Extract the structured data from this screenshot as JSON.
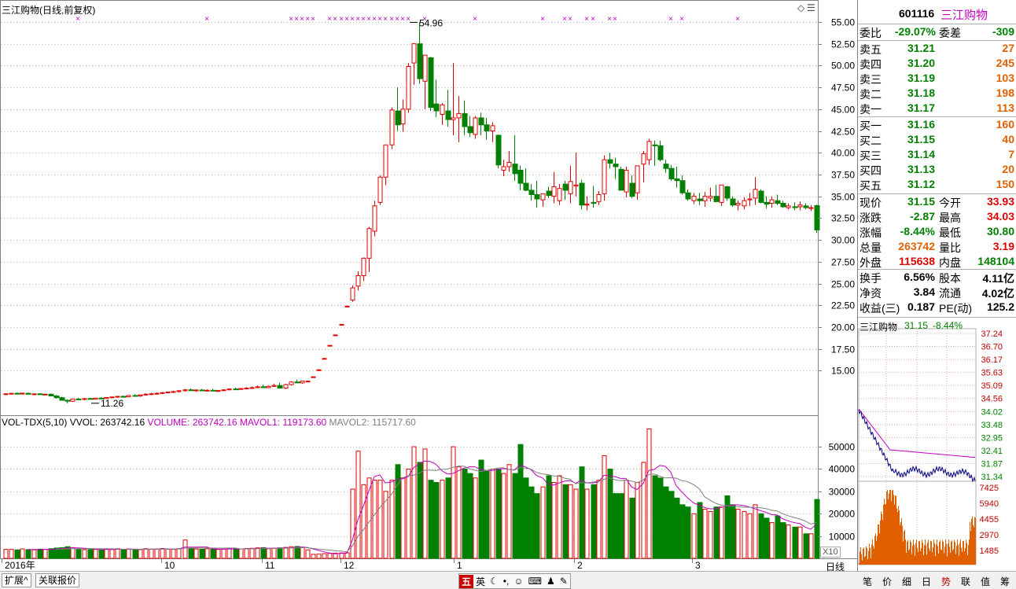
{
  "chart_title": "三江购物(日线,前复权)",
  "stock": {
    "code": "601116",
    "name": "三江购物"
  },
  "colors": {
    "up": "#e00000",
    "down": "#008000",
    "purple": "#c000c0",
    "orange": "#e06000"
  },
  "order_book": {
    "weibi_label": "委比",
    "weibi_value": "-29.07%",
    "weicha_label": "委差",
    "weicha_value": "-309",
    "asks": [
      {
        "label": "卖五",
        "price": "31.21",
        "vol": "27"
      },
      {
        "label": "卖四",
        "price": "31.20",
        "vol": "245"
      },
      {
        "label": "卖三",
        "price": "31.19",
        "vol": "103"
      },
      {
        "label": "卖二",
        "price": "31.18",
        "vol": "198"
      },
      {
        "label": "卖一",
        "price": "31.17",
        "vol": "113"
      }
    ],
    "bids": [
      {
        "label": "买一",
        "price": "31.16",
        "vol": "160"
      },
      {
        "label": "买二",
        "price": "31.15",
        "vol": "40"
      },
      {
        "label": "买三",
        "price": "31.14",
        "vol": "7"
      },
      {
        "label": "买四",
        "price": "31.13",
        "vol": "20"
      },
      {
        "label": "买五",
        "price": "31.12",
        "vol": "150"
      }
    ]
  },
  "quote": [
    {
      "l1": "现价",
      "v1": "31.15",
      "l2": "今开",
      "v2": "33.93"
    },
    {
      "l1": "涨跌",
      "v1": "-2.87",
      "l2": "最高",
      "v2": "34.03"
    },
    {
      "l1": "涨幅",
      "v1": "-8.44%",
      "l2": "最低",
      "v2": "30.80"
    },
    {
      "l1": "总量",
      "v1": "263742",
      "l2": "量比",
      "v2": "3.19"
    },
    {
      "l1": "外盘",
      "v1": "115638",
      "l2": "内盘",
      "v2": "148104"
    }
  ],
  "fundamentals": [
    {
      "l1": "换手",
      "v1": "6.56%",
      "l2": "股本",
      "v2": "4.11亿"
    },
    {
      "l1": "净资",
      "v1": "3.84",
      "l2": "流通",
      "v2": "4.02亿"
    },
    {
      "l1": "收益(三)",
      "v1": "0.187",
      "l2": "PE(动)",
      "v2": "125.2"
    }
  ],
  "intraday": {
    "name": "三江购物",
    "price": "31.15",
    "change": "-8.44%",
    "price_ticks": [
      "37.24",
      "36.70",
      "36.17",
      "35.63",
      "35.09",
      "34.56",
      "34.02",
      "33.48",
      "32.95",
      "32.41",
      "31.87",
      "31.34"
    ],
    "vol_ticks": [
      "7425",
      "5940",
      "4455",
      "2970",
      "1485"
    ]
  },
  "volume_legend": {
    "name": "VOL-TDX(5,10)",
    "vvol": "VVOL: 263742.16",
    "volume": "VOLUME: 263742.16",
    "mavol1": "MAVOL1: 119173.60",
    "mavol2": "MAVOL2: 115717.60"
  },
  "x_labels": [
    "2016年",
    "10",
    "11",
    "12",
    "1",
    "2",
    "3"
  ],
  "period_label": "日线",
  "x10_label": "X10",
  "bottom_tabs": [
    "扩展^",
    "关联报价"
  ],
  "ime_items": [
    "五",
    "英"
  ],
  "right_tabs": [
    "笔",
    "价",
    "细",
    "日",
    "势",
    "联",
    "值",
    "筹"
  ],
  "chart_data": {
    "type": "candlestick",
    "title": "三江购物(日线,前复权)",
    "price_axis": {
      "ticks": [
        15.0,
        17.5,
        20.0,
        22.5,
        25.0,
        27.5,
        30.0,
        32.5,
        35.0,
        37.5,
        40.0,
        42.5,
        45.0,
        47.5,
        50.0,
        52.5,
        55.0
      ]
    },
    "volume_axis": {
      "ticks": [
        10000,
        20000,
        30000,
        40000,
        50000
      ]
    },
    "annotations": [
      {
        "text": "54.96",
        "value": 54.96
      },
      {
        "text": "11.26",
        "value": 11.26
      }
    ],
    "candles": [
      [
        12.3,
        12.4,
        12.2,
        12.35,
        4000
      ],
      [
        12.35,
        12.45,
        12.25,
        12.4,
        4000
      ],
      [
        12.4,
        12.5,
        12.3,
        12.35,
        3800
      ],
      [
        12.35,
        12.45,
        12.25,
        12.42,
        4200
      ],
      [
        12.4,
        12.5,
        12.3,
        12.3,
        3900
      ],
      [
        12.3,
        12.4,
        12.2,
        12.34,
        3800
      ],
      [
        12.34,
        12.42,
        12.25,
        12.28,
        4100
      ],
      [
        12.28,
        12.36,
        12.2,
        12.3,
        4000
      ],
      [
        12.3,
        12.38,
        12.1,
        12.1,
        4300
      ],
      [
        12.1,
        12.2,
        11.8,
        11.9,
        4600
      ],
      [
        11.9,
        12.0,
        11.6,
        11.6,
        4800
      ],
      [
        11.6,
        11.7,
        11.26,
        11.5,
        5200
      ],
      [
        11.5,
        11.8,
        11.4,
        11.75,
        4800
      ],
      [
        11.75,
        11.9,
        11.6,
        11.7,
        4000
      ],
      [
        11.7,
        11.85,
        11.6,
        11.8,
        3900
      ],
      [
        11.8,
        11.9,
        11.7,
        11.72,
        3900
      ],
      [
        11.72,
        11.9,
        11.7,
        11.85,
        4000
      ],
      [
        11.85,
        11.95,
        11.75,
        11.8,
        3800
      ],
      [
        11.8,
        11.95,
        11.75,
        11.92,
        4100
      ],
      [
        11.92,
        12.05,
        11.85,
        11.98,
        4000
      ],
      [
        11.98,
        12.1,
        11.9,
        12.05,
        4300
      ],
      [
        12.05,
        12.15,
        11.95,
        12.0,
        4000
      ],
      [
        12.0,
        12.2,
        11.95,
        12.15,
        4200
      ],
      [
        12.15,
        12.3,
        12.05,
        12.1,
        4000
      ],
      [
        12.1,
        12.25,
        12.0,
        12.22,
        3900
      ],
      [
        12.22,
        12.4,
        12.15,
        12.3,
        4300
      ],
      [
        12.3,
        12.45,
        12.2,
        12.35,
        4100
      ],
      [
        12.35,
        12.5,
        12.25,
        12.4,
        4200
      ],
      [
        12.4,
        12.55,
        12.3,
        12.48,
        4400
      ],
      [
        12.48,
        12.6,
        12.4,
        12.55,
        4100
      ],
      [
        12.55,
        12.7,
        12.45,
        12.6,
        4000
      ],
      [
        12.6,
        12.75,
        12.5,
        12.7,
        4300
      ],
      [
        12.7,
        12.9,
        12.6,
        12.8,
        8200
      ],
      [
        12.8,
        12.95,
        12.7,
        12.72,
        4500
      ],
      [
        12.72,
        12.85,
        12.6,
        12.78,
        4200
      ],
      [
        12.78,
        12.9,
        12.65,
        12.7,
        4100
      ],
      [
        12.7,
        12.85,
        12.6,
        12.75,
        4300
      ],
      [
        12.75,
        12.9,
        12.65,
        12.68,
        4200
      ],
      [
        12.68,
        12.8,
        12.55,
        12.72,
        4000
      ],
      [
        12.72,
        12.85,
        12.65,
        12.8,
        4100
      ],
      [
        12.8,
        12.95,
        12.75,
        12.9,
        4300
      ],
      [
        12.9,
        13.05,
        12.8,
        12.85,
        4400
      ],
      [
        12.85,
        13.0,
        12.8,
        12.95,
        4200
      ],
      [
        12.95,
        13.1,
        12.85,
        13.0,
        4400
      ],
      [
        13.0,
        13.2,
        12.95,
        13.05,
        4500
      ],
      [
        13.05,
        13.3,
        13.0,
        13.15,
        4700
      ],
      [
        13.15,
        13.4,
        13.05,
        13.05,
        4800
      ],
      [
        13.05,
        13.3,
        13.0,
        13.2,
        4300
      ],
      [
        13.2,
        13.5,
        13.15,
        13.3,
        4500
      ],
      [
        13.3,
        13.6,
        13.25,
        13.0,
        4700
      ],
      [
        13.0,
        13.5,
        12.9,
        13.4,
        4900
      ],
      [
        13.4,
        13.8,
        13.3,
        13.7,
        5200
      ],
      [
        13.7,
        14.0,
        13.6,
        13.6,
        5300
      ],
      [
        13.6,
        13.8,
        13.5,
        13.8,
        5000
      ],
      [
        13.8,
        13.85,
        13.8,
        13.8,
        3800
      ],
      [
        14.3,
        14.35,
        14.3,
        14.3,
        1800
      ],
      [
        15.1,
        15.15,
        15.1,
        15.1,
        1900
      ],
      [
        16.4,
        16.45,
        16.4,
        16.4,
        2100
      ],
      [
        17.9,
        17.95,
        17.9,
        17.9,
        2200
      ],
      [
        19.1,
        19.15,
        19.1,
        19.1,
        2300
      ],
      [
        20.3,
        20.35,
        20.3,
        20.3,
        2400
      ],
      [
        22.4,
        22.45,
        22.4,
        22.4,
        2500
      ],
      [
        23.1,
        24.8,
        22.9,
        24.5,
        31000
      ],
      [
        24.7,
        26.4,
        24.2,
        25.9,
        48000
      ],
      [
        25.9,
        28.0,
        25.3,
        27.9,
        33000
      ],
      [
        27.9,
        31.5,
        26.3,
        31.3,
        36000
      ],
      [
        31.0,
        34.5,
        30.4,
        33.9,
        35000
      ],
      [
        34.3,
        37.4,
        34.0,
        37.2,
        35000
      ],
      [
        37.2,
        40.9,
        36.3,
        40.9,
        30000
      ],
      [
        40.9,
        45.2,
        40.4,
        44.9,
        35000
      ],
      [
        44.8,
        47.5,
        42.5,
        43.2,
        42000
      ],
      [
        43.3,
        46.1,
        42.4,
        45.0,
        36000
      ],
      [
        45.0,
        50.3,
        44.6,
        49.9,
        40000
      ],
      [
        50.3,
        52.6,
        47.8,
        52.5,
        50000
      ],
      [
        52.5,
        54.96,
        47.9,
        48.5,
        43000
      ],
      [
        48.2,
        50.5,
        45.0,
        51.2,
        49000
      ],
      [
        50.9,
        51.0,
        44.8,
        45.2,
        35000
      ],
      [
        45.6,
        48.4,
        44.1,
        44.8,
        34000
      ],
      [
        44.4,
        45.7,
        43.2,
        45.5,
        35000
      ],
      [
        44.8,
        47.2,
        43.0,
        43.8,
        36000
      ],
      [
        43.8,
        50.3,
        42.0,
        44.0,
        50000
      ],
      [
        44.0,
        46.5,
        41.2,
        44.5,
        41000
      ],
      [
        44.5,
        46.0,
        42.0,
        43.0,
        40000
      ],
      [
        43.0,
        44.2,
        41.8,
        42.3,
        38000
      ],
      [
        42.1,
        44.2,
        41.6,
        44.0,
        36000
      ],
      [
        44.0,
        44.6,
        42.0,
        43.2,
        44000
      ],
      [
        43.2,
        44.0,
        41.5,
        42.5,
        39000
      ],
      [
        42.5,
        43.5,
        41.2,
        43.1,
        40000
      ],
      [
        42.0,
        42.1,
        38.2,
        38.6,
        40000
      ],
      [
        38.0,
        39.2,
        37.3,
        38.4,
        38000
      ],
      [
        38.4,
        40.2,
        37.8,
        38.9,
        42000
      ],
      [
        38.7,
        42.0,
        36.8,
        37.6,
        38000
      ],
      [
        38.0,
        38.5,
        35.7,
        36.5,
        51000
      ],
      [
        36.5,
        38.2,
        35.6,
        35.7,
        36000
      ],
      [
        35.7,
        36.4,
        34.5,
        35.2,
        32000
      ],
      [
        35.2,
        36.8,
        33.7,
        34.7,
        29000
      ],
      [
        34.6,
        35.3,
        33.8,
        35.3,
        32000
      ],
      [
        35.6,
        36.1,
        34.8,
        35.1,
        37000
      ],
      [
        35.0,
        37.8,
        34.2,
        36.1,
        34000
      ],
      [
        34.5,
        36.4,
        34.0,
        35.9,
        37000
      ],
      [
        36.4,
        36.8,
        34.6,
        35.7,
        33000
      ],
      [
        35.3,
        38.5,
        34.2,
        36.7,
        33000
      ],
      [
        36.2,
        40.0,
        35.0,
        36.3,
        31000
      ],
      [
        36.5,
        36.9,
        33.5,
        34.0,
        41000
      ],
      [
        34.0,
        35.0,
        33.4,
        34.1,
        31000
      ],
      [
        34.3,
        36.2,
        33.7,
        34.2,
        33000
      ],
      [
        34.4,
        35.6,
        34.0,
        35.2,
        35000
      ],
      [
        35.3,
        39.7,
        34.5,
        39.2,
        46000
      ],
      [
        39.2,
        40.0,
        38.2,
        38.8,
        40000
      ],
      [
        38.7,
        39.4,
        37.0,
        38.4,
        29000
      ],
      [
        38.1,
        38.4,
        35.8,
        35.7,
        29000
      ],
      [
        35.5,
        38.4,
        34.9,
        38.0,
        35000
      ],
      [
        36.5,
        37.4,
        34.8,
        35.0,
        27000
      ],
      [
        35.4,
        38.4,
        34.6,
        38.5,
        34000
      ],
      [
        38.7,
        40.2,
        36.6,
        39.9,
        43000
      ],
      [
        39.2,
        41.6,
        38.6,
        41.3,
        58000
      ],
      [
        40.9,
        41.4,
        38.5,
        40.8,
        37000
      ],
      [
        40.8,
        41.4,
        39.0,
        39.2,
        36000
      ],
      [
        38.7,
        39.2,
        37.7,
        38.2,
        32000
      ],
      [
        38.2,
        38.6,
        36.8,
        37.0,
        30000
      ],
      [
        37.0,
        38.4,
        36.0,
        36.8,
        27000
      ],
      [
        36.8,
        37.4,
        35.2,
        35.4,
        24000
      ],
      [
        35.4,
        35.8,
        34.5,
        34.7,
        23000
      ],
      [
        34.5,
        35.4,
        34.1,
        35.0,
        20000
      ],
      [
        34.7,
        35.4,
        34.0,
        34.5,
        25000
      ],
      [
        34.5,
        35.5,
        33.8,
        35.0,
        22000
      ],
      [
        34.8,
        36.0,
        34.4,
        35.0,
        21000
      ],
      [
        35.0,
        36.3,
        34.3,
        34.4,
        23000
      ],
      [
        34.3,
        36.3,
        33.9,
        36.3,
        23000
      ],
      [
        36.1,
        36.2,
        34.5,
        34.8,
        28000
      ],
      [
        34.7,
        35.0,
        33.8,
        34.0,
        24000
      ],
      [
        34.0,
        34.5,
        33.4,
        34.2,
        22000
      ],
      [
        33.9,
        34.9,
        33.5,
        34.5,
        21000
      ],
      [
        34.6,
        35.4,
        33.9,
        34.7,
        20000
      ],
      [
        34.8,
        37.2,
        34.0,
        35.8,
        24000
      ],
      [
        35.6,
        35.8,
        34.2,
        34.3,
        20000
      ],
      [
        34.3,
        35.0,
        33.6,
        34.1,
        18000
      ],
      [
        34.2,
        35.0,
        33.7,
        34.6,
        16000
      ],
      [
        34.5,
        35.2,
        34.0,
        34.2,
        19000
      ],
      [
        34.2,
        34.5,
        33.7,
        33.8,
        16000
      ],
      [
        33.7,
        34.2,
        33.5,
        33.9,
        15000
      ],
      [
        33.8,
        34.3,
        33.4,
        33.7,
        14000
      ],
      [
        33.8,
        34.4,
        33.4,
        34.0,
        14000
      ],
      [
        33.9,
        34.2,
        33.5,
        33.7,
        11000
      ],
      [
        33.7,
        34.0,
        33.3,
        33.7,
        11000
      ],
      [
        33.93,
        34.03,
        30.8,
        31.15,
        26374
      ]
    ]
  }
}
